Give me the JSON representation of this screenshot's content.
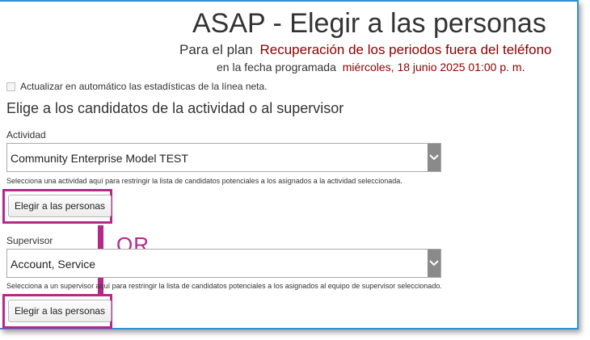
{
  "header": {
    "title": "ASAP - Elegir a las personas",
    "plan_prefix": "Para el plan",
    "plan_name": "Recuperación de los periodos fuera del teléfono",
    "date_prefix": "en la fecha programada",
    "date_value": "miércoles, 18 junio 2025 01:00 p. m."
  },
  "auto_refresh": {
    "label": "Actualizar en automático las estadísticas de la línea neta.",
    "checked": false
  },
  "section_heading": "Elige a los candidatos de la actividad o al supervisor",
  "activity": {
    "label": "Actividad",
    "selected": "Community Enterprise Model TEST",
    "help": "Selecciona una actividad aquí para restringir la lista de candidatos potenciales a los asignados a la actividad seleccionada.",
    "button_label": "Elegir a las personas"
  },
  "supervisor": {
    "label": "Supervisor",
    "selected": "Account, Service",
    "help": "Selecciona a un supervisor aquí para restringir la lista de candidatos potenciales a los asignados al equipo de supervisor seleccionado.",
    "button_label": "Elegir a las personas"
  },
  "annotation": {
    "or_label": "OR",
    "color": "#b5288a"
  },
  "colors": {
    "value_text": "#8b0000",
    "frame_border": "#2f8fd3",
    "dropdown_arrow_bg": "#8a8a8a"
  },
  "icons": {
    "dropdown": "chevron-down-icon"
  }
}
